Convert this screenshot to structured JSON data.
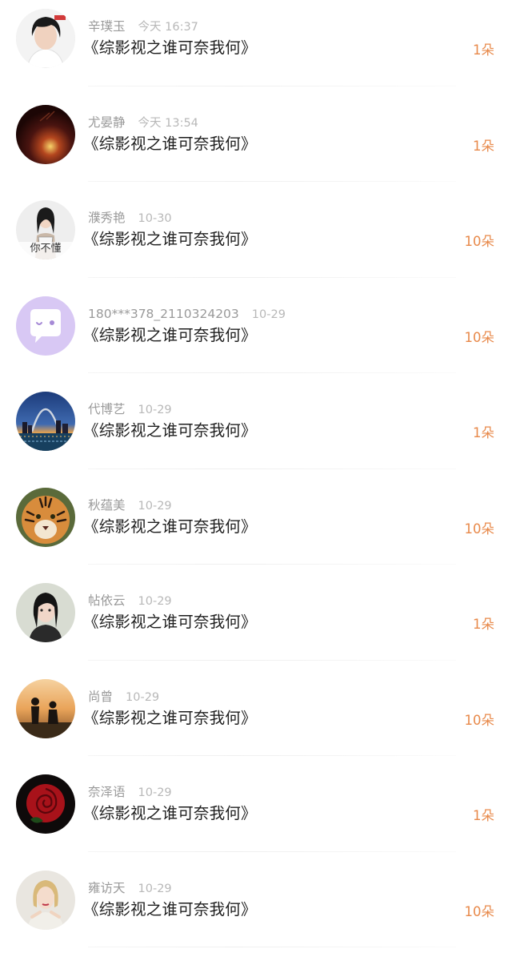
{
  "items": [
    {
      "name": "辛璞玉",
      "time": "今天 16:37",
      "title": "《综影视之谁可奈我何》",
      "count": "1朵",
      "avatar_icon": "person-portrait-icon"
    },
    {
      "name": "尤晏静",
      "time": "今天 13:54",
      "title": "《综影视之谁可奈我何》",
      "count": "1朵",
      "avatar_icon": "dark-glow-icon"
    },
    {
      "name": "濮秀艳",
      "time": "10-30",
      "title": "《综影视之谁可奈我何》",
      "count": "10朵",
      "avatar_icon": "girl-portrait-icon",
      "avatar_text": "你不懂"
    },
    {
      "name": "180***378_2110324203",
      "time": "10-29",
      "title": "《综影视之谁可奈我何》",
      "count": "10朵",
      "avatar_icon": "chat-bubble-icon"
    },
    {
      "name": "代博艺",
      "time": "10-29",
      "title": "《综影视之谁可奈我何》",
      "count": "1朵",
      "avatar_icon": "city-arch-icon"
    },
    {
      "name": "秋蕴美",
      "time": "10-29",
      "title": "《综影视之谁可奈我何》",
      "count": "10朵",
      "avatar_icon": "tiger-icon"
    },
    {
      "name": "帖依云",
      "time": "10-29",
      "title": "《综影视之谁可奈我何》",
      "count": "1朵",
      "avatar_icon": "woman-portrait-icon"
    },
    {
      "name": "尚曾",
      "time": "10-29",
      "title": "《综影视之谁可奈我何》",
      "count": "10朵",
      "avatar_icon": "sunset-couple-icon"
    },
    {
      "name": "奈泽语",
      "time": "10-29",
      "title": "《综影视之谁可奈我何》",
      "count": "1朵",
      "avatar_icon": "red-rose-icon"
    },
    {
      "name": "雍访天",
      "time": "10-29",
      "title": "《综影视之谁可奈我何》",
      "count": "10朵",
      "avatar_icon": "blonde-portrait-icon"
    }
  ],
  "colors": {
    "name": "#9a9a9a",
    "time": "#b8b8b8",
    "title": "#1e1e1e",
    "count": "#e8894a",
    "chat_avatar_bg": "#d8c8f4"
  }
}
